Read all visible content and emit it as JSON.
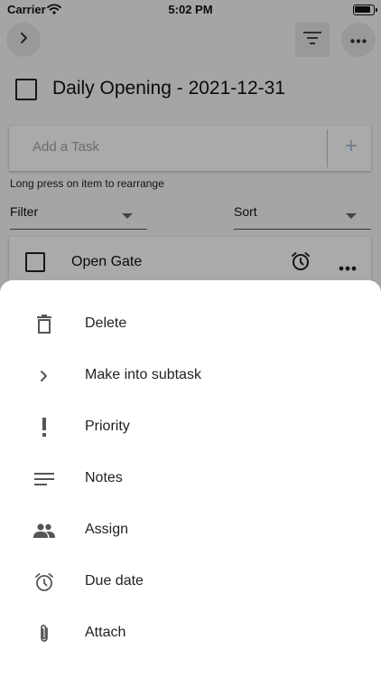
{
  "status_bar": {
    "carrier": "Carrier",
    "time": "5:02 PM",
    "wifi_icon": "wifi-icon",
    "battery_icon": "battery-icon"
  },
  "toolbar": {
    "expand_icon": "chevron-right-icon",
    "filter_icon": "filter-list-icon",
    "more_icon": "more-horizontal-icon"
  },
  "list": {
    "title": "Daily Opening - 2021-12-31",
    "completed": false
  },
  "add_task": {
    "placeholder": "Add a Task",
    "add_label": "+"
  },
  "hint": "Long press on item to rearrange",
  "filter": {
    "label": "Filter"
  },
  "sort": {
    "label": "Sort"
  },
  "tasks": [
    {
      "title": "Open Gate",
      "completed": false,
      "alarm_icon": "alarm-icon",
      "more_icon": "more-horizontal-icon"
    }
  ],
  "action_sheet": {
    "items": [
      {
        "label": "Delete",
        "icon": "trash-icon"
      },
      {
        "label": "Make into subtask",
        "icon": "chevron-right-icon"
      },
      {
        "label": "Priority",
        "icon": "exclamation-icon"
      },
      {
        "label": "Notes",
        "icon": "notes-icon"
      },
      {
        "label": "Assign",
        "icon": "people-icon"
      },
      {
        "label": "Due date",
        "icon": "alarm-icon"
      },
      {
        "label": "Attach",
        "icon": "paperclip-icon"
      }
    ]
  },
  "colors": {
    "background": "#f4f4f4",
    "sheet": "#ffffff",
    "icon": "#555555",
    "accent_plus": "#9fb6d6"
  }
}
